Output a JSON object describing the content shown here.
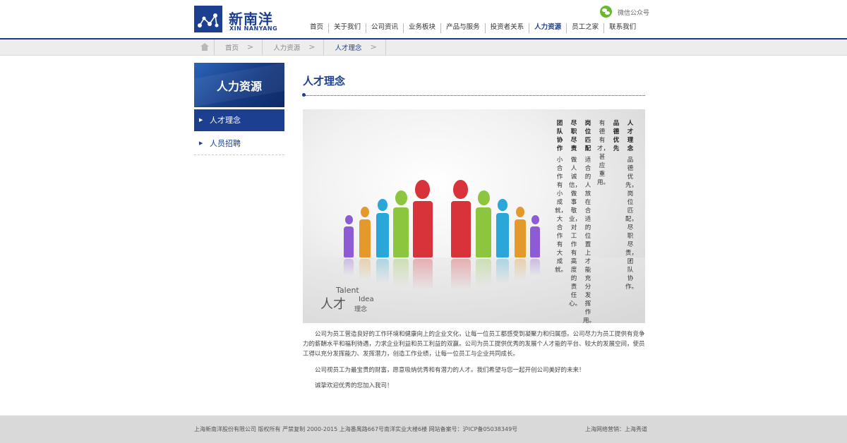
{
  "header": {
    "logo_cn": "新南洋",
    "logo_en": "XIN NANYANG",
    "wechat_label": "微信公众号",
    "nav": [
      "首页",
      "关于我们",
      "公司资讯",
      "业务板块",
      "产品与服务",
      "投资者关系",
      "人力资源",
      "员工之家",
      "联系我们"
    ],
    "nav_active": "人力资源"
  },
  "breadcrumb": {
    "items": [
      "首页",
      "人力资源",
      "人才理念"
    ],
    "sep": ">"
  },
  "sidebar": {
    "title": "人力资源",
    "items": [
      {
        "label": "人才理念",
        "arrow": "▶"
      },
      {
        "label": "人员招聘",
        "arrow": "▶"
      }
    ]
  },
  "main": {
    "title": "人才理念",
    "banner": {
      "caption_en_1": "Talent",
      "caption_cn_1": "人才",
      "caption_en_2": "Idea",
      "caption_cn_2": "理念",
      "columns": [
        {
          "text": "人才理念",
          "heading": true
        },
        {
          "text": "品德优先，岗位匹配，尽职尽责，团队协作。",
          "heading": false
        },
        {
          "text": "品德优先",
          "heading": true
        },
        {
          "text": "有德有才，甚应重用。",
          "heading": false
        },
        {
          "text": "岗位匹配",
          "heading": true
        },
        {
          "text": "适合的人放在合适的位置上才能充分发挥作用。",
          "heading": false
        },
        {
          "text": "尽职尽责",
          "heading": true
        },
        {
          "text": "做人诚信，做事敬业，对工作有高度的责任心。",
          "heading": false
        },
        {
          "text": "团队协作",
          "heading": true
        },
        {
          "text": "小合作有小成就，大合作有大成就。",
          "heading": false
        }
      ]
    },
    "paragraphs": [
      "公司为员工营造良好的工作环境和健康向上的企业文化，让每一位员工都感受到凝聚力和归属感。公司尽力为员工提供有竞争力的薪酬水平和福利待遇，力求企业利益和员工利益的双赢。公司为员工提供优秀的发展个人才能的平台、较大的发展空间，使员工得以充分发挥能力、发挥潜力，创造工作业绩，让每一位员工与企业共同成长。",
      "公司视员工为最宝贵的财富，愿意吸纳优秀和有潜力的人才。我们希望与您一起开创公司美好的未来！",
      "诚挚欢迎优秀的您加入我司！"
    ]
  },
  "footer": {
    "left": "上海新南洋股份有限公司    版权所有    严禁复制    2000-2015    上海番禺路667号南洋实业大楼6楼    网站备案号：沪ICP备05038349号",
    "right": "上海网络营销：上海秀道"
  },
  "colors": {
    "brand": "#1c3f8f",
    "footer_bg": "#d9d9d9",
    "crumb_bg": "#ededed",
    "wechat": "#6ab82e"
  },
  "figures": {
    "colors": [
      "#8e5bd6",
      "#e39a2a",
      "#2aa6d8",
      "#8cc63f",
      "#d8323a",
      "#d8323a",
      "#8cc63f",
      "#2aa6d8",
      "#e39a2a",
      "#8e5bd6"
    ]
  }
}
